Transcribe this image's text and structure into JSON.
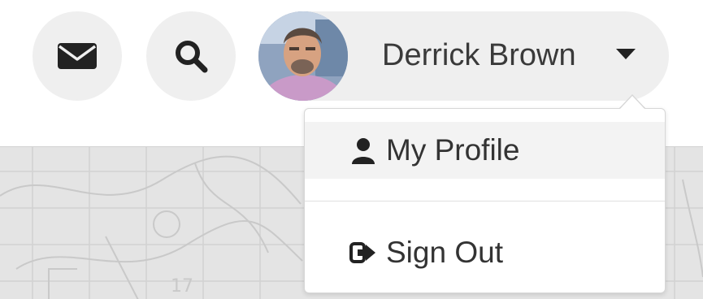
{
  "header": {
    "mail_icon": "envelope-icon",
    "search_icon": "search-icon",
    "user": {
      "name": "Derrick Brown",
      "avatar": "user-avatar-photo",
      "menu_toggle_icon": "caret-down-icon"
    }
  },
  "user_menu": {
    "items": [
      {
        "label": "My Profile",
        "icon": "user-icon"
      },
      {
        "label": "Sign Out",
        "icon": "sign-out-icon"
      }
    ]
  },
  "colors": {
    "button_bg": "#efefef",
    "menu_hover_bg": "#f3f3f3",
    "text": "#333333",
    "icon": "#222222",
    "background_sketch": "#e4e4e4"
  }
}
